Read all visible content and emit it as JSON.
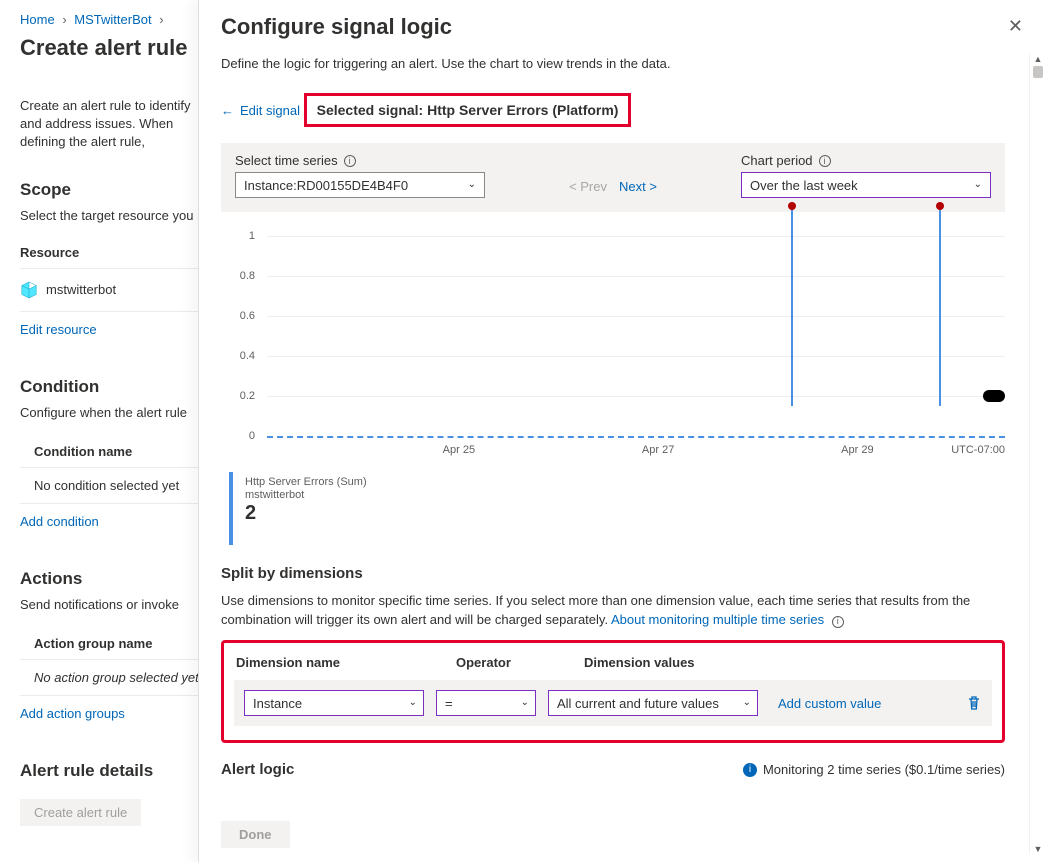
{
  "breadcrumb": {
    "home": "Home",
    "app": "MSTwitterBot"
  },
  "page": {
    "title": "Create alert rule",
    "desc": "Create an alert rule to identify and address issues. When defining the alert rule,",
    "scope": {
      "heading": "Scope",
      "sub": "Select the target resource you",
      "resource_label": "Resource",
      "resource_name": "mstwitterbot",
      "edit_link": "Edit resource"
    },
    "condition": {
      "heading": "Condition",
      "sub": "Configure when the alert rule",
      "name_label": "Condition name",
      "none": "No condition selected yet",
      "add_link": "Add condition"
    },
    "actions": {
      "heading": "Actions",
      "sub": "Send notifications or invoke",
      "group_label": "Action group name",
      "none": "No action group selected yet",
      "add_link": "Add action groups"
    },
    "details": {
      "heading": "Alert rule details"
    },
    "create_btn": "Create alert rule"
  },
  "panel": {
    "title": "Configure signal logic",
    "desc": "Define the logic for triggering an alert. Use the chart to view trends in the data.",
    "edit_signal": "Edit signal",
    "selected_signal": "Selected signal: Http Server Errors (Platform)",
    "toolbar": {
      "time_series_label": "Select time series",
      "time_series_value": "Instance:RD00155DE4B4F0",
      "prev": "< Prev",
      "next": "Next >",
      "chart_period_label": "Chart period",
      "chart_period_value": "Over the last week"
    },
    "legend": {
      "metric": "Http Server Errors (Sum)",
      "resource": "mstwitterbot",
      "value": "2"
    },
    "split": {
      "heading": "Split by dimensions",
      "desc": "Use dimensions to monitor specific time series. If you select more than one dimension value, each time series that results from the combination will trigger its own alert and will be charged separately.",
      "about_link": "About monitoring multiple time series",
      "col_name": "Dimension name",
      "col_op": "Operator",
      "col_vals": "Dimension values",
      "row": {
        "name": "Instance",
        "op": "=",
        "vals": "All current and future values",
        "add_custom": "Add custom value"
      }
    },
    "alert_logic": {
      "heading": "Alert logic",
      "monitoring": "Monitoring 2 time series ($0.1/time series)"
    },
    "done": "Done"
  },
  "chart_data": {
    "type": "line",
    "title": "",
    "ylim": [
      0,
      1
    ],
    "y_ticks": [
      0,
      0.2,
      0.4,
      0.6,
      0.8,
      1
    ],
    "x_ticks": [
      "Apr 25",
      "Apr 27",
      "Apr 29"
    ],
    "timezone": "UTC-07:00",
    "series": [
      {
        "name": "Http Server Errors (Sum)",
        "color": "#4a90e2",
        "x": [
          "Apr 23",
          "Apr 24",
          "Apr 25",
          "Apr 26",
          "Apr 27",
          "Apr 28",
          "Apr 28.5",
          "Apr 29",
          "Apr 29.7",
          "Apr 30"
        ],
        "values": [
          0,
          0,
          0,
          0,
          0,
          0,
          1,
          0,
          1,
          0
        ]
      }
    ],
    "sum": 2
  }
}
